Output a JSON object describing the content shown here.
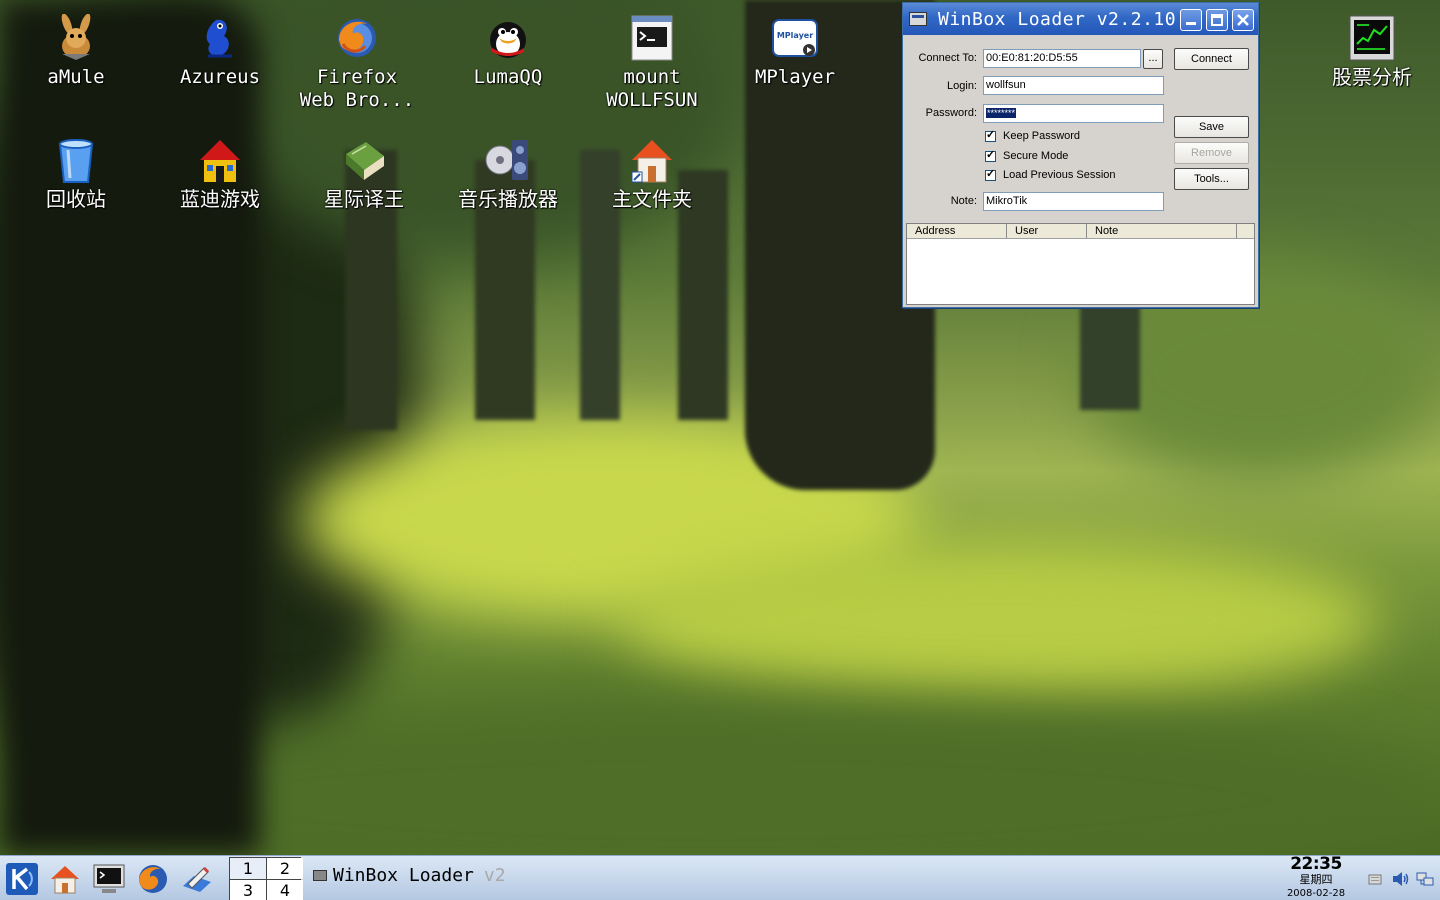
{
  "desktop": {
    "icons": [
      {
        "label": "aMule"
      },
      {
        "label": "Azureus"
      },
      {
        "label": "Firefox\nWeb Bro..."
      },
      {
        "label": "LumaQQ"
      },
      {
        "label": "mount\nWOLLFSUN"
      },
      {
        "label": "MPlayer"
      },
      {
        "label": "股票分析"
      },
      {
        "label": "回收站"
      },
      {
        "label": "蓝迪游戏"
      },
      {
        "label": "星际译王"
      },
      {
        "label": "音乐播放器"
      },
      {
        "label": "主文件夹"
      }
    ]
  },
  "winbox": {
    "title": "WinBox Loader v2.2.10",
    "labels": {
      "connect_to": "Connect To:",
      "login": "Login:",
      "password": "Password:",
      "note": "Note:"
    },
    "fields": {
      "connect_to": "00:E0:81:20:D5:55",
      "login": "wollfsun",
      "password": "********",
      "note": "MikroTik"
    },
    "buttons": {
      "browse": "...",
      "connect": "Connect",
      "save": "Save",
      "remove": "Remove",
      "tools": "Tools..."
    },
    "checkboxes": [
      {
        "label": "Keep Password",
        "checked": true
      },
      {
        "label": "Secure Mode",
        "checked": true
      },
      {
        "label": "Load Previous Session",
        "checked": true
      }
    ],
    "table_headers": [
      "Address",
      "User",
      "Note"
    ]
  },
  "taskbar": {
    "pager": [
      "1",
      "2",
      "3",
      "4"
    ],
    "task": {
      "title": "WinBox Loader",
      "tail": "v2"
    },
    "clock": {
      "time": "22:35",
      "day": "星期四",
      "date": "2008-02-28"
    }
  },
  "colors": {
    "titlebar": "#3168c6",
    "window_bg": "#d6d3ce",
    "taskbar": "#c8d8ec"
  }
}
